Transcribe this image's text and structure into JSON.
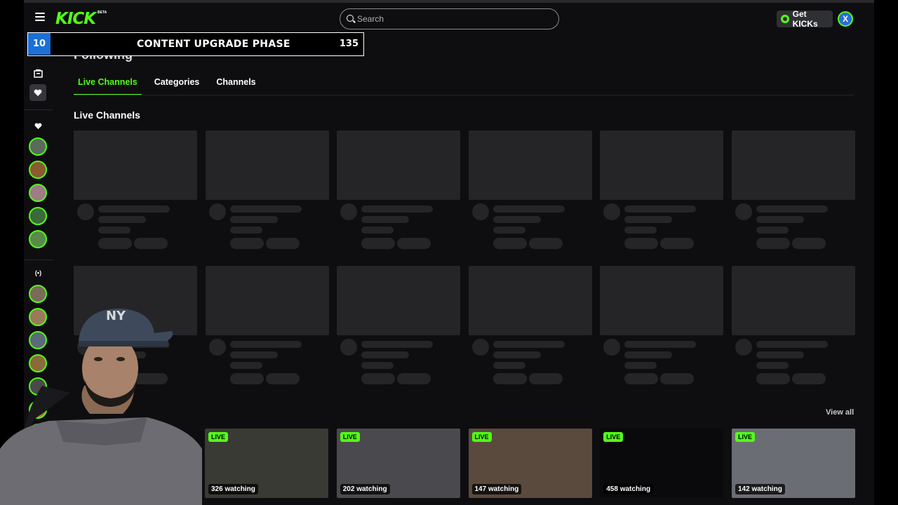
{
  "header": {
    "logo": "KICK",
    "logo_badge": "BETA",
    "search_placeholder": "Search",
    "kicks_label": "Get KICKs",
    "profile_initial": "X"
  },
  "overlay": {
    "phase_number": "10",
    "phase_title": "CONTENT UPGRADE PHASE",
    "phase_count": "135"
  },
  "page": {
    "title": "Following",
    "tabs": [
      {
        "label": "Live Channels",
        "active": true
      },
      {
        "label": "Categories",
        "active": false
      },
      {
        "label": "Channels",
        "active": false
      }
    ],
    "section_title": "Live Channels",
    "view_all": "View all"
  },
  "sidebar": {
    "live_label": "(•)",
    "following_avatars": [
      "#5a6a5e",
      "#8a5a30",
      "#a07a86",
      "#3a6a3a",
      "#5a8a4a"
    ],
    "live_avatars": [
      "#7a6a5a",
      "#9a7a5a",
      "#5a6a7a",
      "#8a6a3a",
      "#4a4a4a",
      "#aa7a3a",
      "#5a7a5a"
    ]
  },
  "live_streams": [
    {
      "badge": "LIVE",
      "viewers": "326 watching",
      "bg": "#3a3a34"
    },
    {
      "badge": "LIVE",
      "viewers": "202 watching",
      "bg": "#4a4a4e"
    },
    {
      "badge": "LIVE",
      "viewers": "147 watching",
      "bg": "#5a4a3e"
    },
    {
      "badge": "LIVE",
      "viewers": "458 watching",
      "bg": "#0a0a0c"
    },
    {
      "badge": "LIVE",
      "viewers": "142 watching",
      "bg": "#6a6e74"
    }
  ],
  "colors": {
    "accent": "#53fc18",
    "background": "#0e0e10",
    "skeleton": "#252528",
    "phase_blue": "#1b6fd6"
  }
}
